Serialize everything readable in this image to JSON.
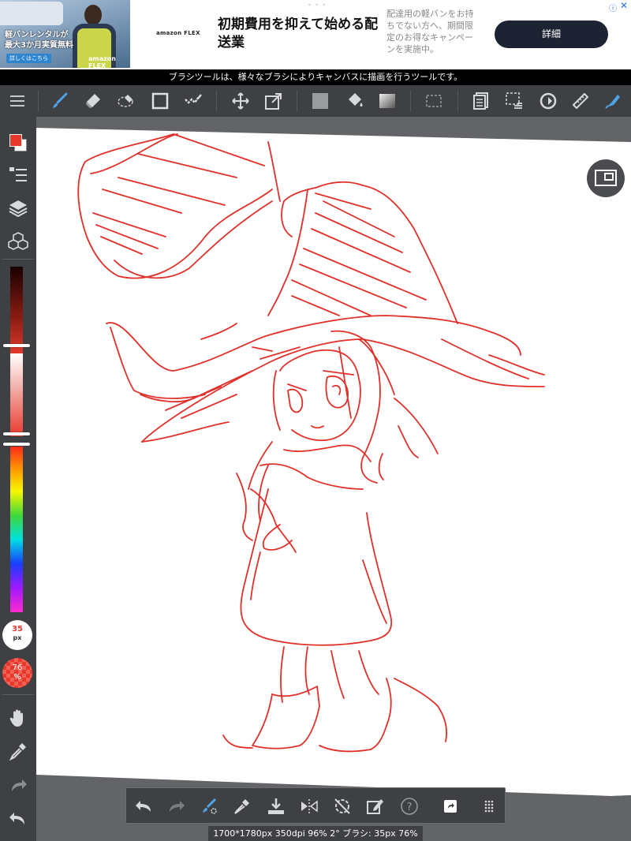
{
  "ad": {
    "photo_text_line1": "軽バンレンタルが",
    "photo_text_line2": "最大3か月実質無料",
    "photo_button": "詳しくはこちら",
    "photo_logo": "amazon FLEX",
    "brand": "amazon FLEX",
    "headline": "初期費用を抑えて始める配送業",
    "description": "配達用の軽バンをお持ちでない方へ、期間限定のお得なキャンペーンを実施中。",
    "cta_label": "詳細",
    "info_icon": "ⓘ",
    "close_icon": "✕"
  },
  "tooltip": "ブラシツールは、様々なブラシによりキャンバスに描画を行うツールです。",
  "toolbar": {
    "icons": [
      "menu-icon",
      "brush-icon",
      "eraser-icon",
      "lasso-icon",
      "rectangle-icon",
      "dot-brush-icon",
      "move-icon",
      "transform-icon",
      "fill-color-icon",
      "bucket-icon",
      "gradient-icon",
      "selection-icon",
      "copy-icon",
      "select-menu-icon",
      "rotate-icon",
      "ruler-icon",
      "pen-icon"
    ]
  },
  "sidebar": {
    "foreground_color": "#e8382c",
    "background_color": "#ffffff",
    "brush_size_label": "35 px",
    "brush_size_num": "35",
    "brush_size_unit": "px",
    "opacity_num": "76",
    "opacity_unit": "%"
  },
  "status": "1700*1780px 350dpi 96% 2° ブラシ: 35px 76%",
  "colors": {
    "toolbar_bg": "#3e4043",
    "canvas_bg": "#626468",
    "accent_blue": "#4da3e6",
    "ink_red": "#e0302a"
  }
}
